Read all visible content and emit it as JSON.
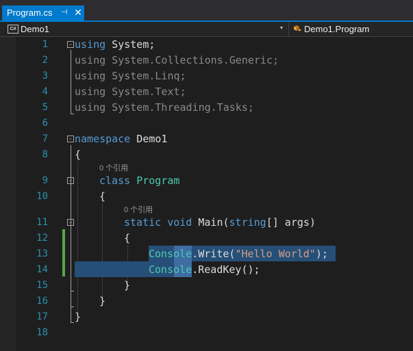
{
  "tab": {
    "title": "Program.cs",
    "pin": "⊣",
    "close": "✕"
  },
  "navbar": {
    "project": "Demo1",
    "cs_icon_text": "C#",
    "member": "Demo1.Program",
    "dropdown_arrow": "▾"
  },
  "line_numbers": [
    "1",
    "2",
    "3",
    "4",
    "5",
    "6",
    "7",
    "8",
    "9",
    "10",
    "11",
    "12",
    "13",
    "14",
    "15",
    "16",
    "17",
    "18"
  ],
  "codelens": {
    "class_refs": "0 个引用",
    "method_refs": "0 个引用"
  },
  "code": {
    "l1": {
      "kw": "using",
      "rest": " System;"
    },
    "l2": {
      "kw": "using",
      "rest": " System.Collections.Generic;"
    },
    "l3": {
      "kw": "using",
      "rest": " System.Linq;"
    },
    "l4": {
      "kw": "using",
      "rest": " System.Text;"
    },
    "l5": {
      "kw": "using",
      "rest": " System.Threading.Tasks;"
    },
    "l7": {
      "kw": "namespace",
      "rest": " Demo1"
    },
    "l8": "{",
    "l9": {
      "kw": "class",
      "type": "Program"
    },
    "l10": "{",
    "l11": {
      "kw1": "static",
      "kw2": "void",
      "name": " Main(",
      "kw3": "string",
      "rest": "[] args)"
    },
    "l12": "{",
    "l13": {
      "type": "Console",
      "mid": ".Write(",
      "str": "\"Hello World\"",
      "end": ");"
    },
    "l14": {
      "type": "Console",
      "rest": ".ReadKey();"
    },
    "l15": "}",
    "l16": "}",
    "l17": "}"
  },
  "colors": {
    "keyword": "#569cd6",
    "type": "#4ec9b0",
    "string": "#d69d85",
    "line_number": "#2b91af",
    "accent": "#007acc",
    "change_bar": "#57a64a"
  }
}
